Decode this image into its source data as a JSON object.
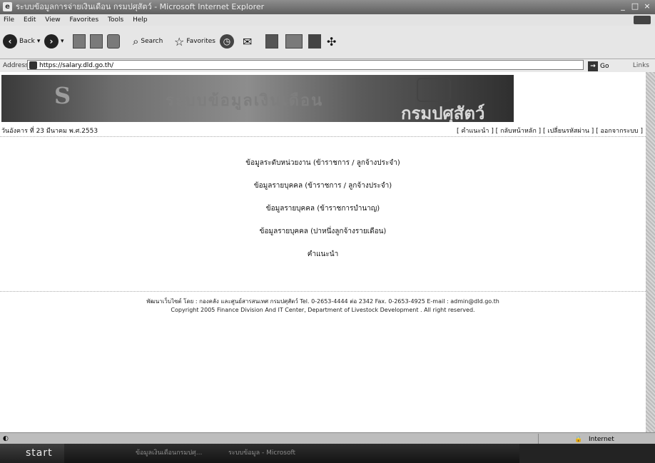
{
  "window": {
    "title": "ระบบข้อมูลการจ่ายเงินเดือน กรมปศุสัตว์ - Microsoft Internet Explorer",
    "controls": [
      "_",
      "□",
      "×"
    ]
  },
  "menubar": [
    "File",
    "Edit",
    "View",
    "Favorites",
    "Tools",
    "Help"
  ],
  "toolbar": {
    "back_label": "Back",
    "search_label": "Search",
    "favorites_label": "Favorites"
  },
  "address": {
    "label": "Address",
    "url": "https://salary.dld.go.th/",
    "go_label": "Go",
    "links_label": "Links"
  },
  "page": {
    "banner_left": "S",
    "banner_mid": "ระบบข้อมูลเงินเดือน",
    "banner_logo": "กรมปศุสัตว์",
    "date": "วันอังคาร ที่ 23 มีนาคม พ.ศ.2553",
    "nav": [
      "คำแนะนำ",
      "กลับหน้าหลัก",
      "เปลี่ยนรหัสผ่าน",
      "ออกจากระบบ"
    ],
    "menu": [
      "ข้อมูลระดับหน่วยงาน (ข้าราชการ / ลูกจ้างประจำ)",
      "ข้อมูลรายบุคคล (ข้าราชการ / ลูกจ้างประจำ)",
      "ข้อมูลรายบุคคล (ข้าราชการบำนาญ)",
      "ข้อมูลรายบุคคล (ปาหนึ่งลูกจ้างรายเดือน)",
      "คำแนะนำ"
    ],
    "footer_line1": "พัฒนาเว็บไซต์ โดย : กองคลัง และศูนย์สารสนเทศ กรมปศุสัตว์ Tel. 0-2653-4444 ต่อ 2342 Fax. 0-2653-4925 E-mail : admin@dld.go.th",
    "footer_line2": "Copyright 2005 Finance Division And IT Center, Department of Livestock Development . All right reserved."
  },
  "status": {
    "zone": "Internet"
  },
  "taskbar": {
    "start": "start",
    "tasks": [
      "ข้อมูลเงินเดือนกรมปศุ...",
      "ระบบข้อมูล - Microsoft"
    ]
  }
}
